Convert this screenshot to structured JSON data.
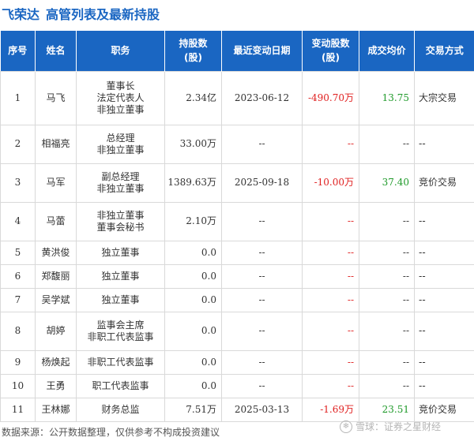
{
  "title": {
    "company": "飞荣达",
    "subtitle": "高管列表及最新持股"
  },
  "table": {
    "headers": [
      "序号",
      "姓名",
      "职务",
      "持股数\n(股)",
      "最近变动日期",
      "变动股数\n(股)",
      "成交均价",
      "交易方式"
    ],
    "rows": [
      {
        "no": "1",
        "name": "马飞",
        "roles": [
          "董事长",
          "法定代表人",
          "非独立董事"
        ],
        "shares": "2.34亿",
        "date": "2023-06-12",
        "change": "-490.70万",
        "price": "13.75",
        "method": "大宗交易"
      },
      {
        "no": "2",
        "name": "相福亮",
        "roles": [
          "总经理",
          "非独立董事"
        ],
        "shares": "33.00万",
        "date": "--",
        "change": "--",
        "price": "--",
        "method": "--"
      },
      {
        "no": "3",
        "name": "马军",
        "roles": [
          "副总经理",
          "非独立董事"
        ],
        "shares": "1389.63万",
        "date": "2025-09-18",
        "change": "-10.00万",
        "price": "37.40",
        "method": "竞价交易"
      },
      {
        "no": "4",
        "name": "马蕾",
        "roles": [
          "非独立董事",
          "董事会秘书"
        ],
        "shares": "2.10万",
        "date": "--",
        "change": "--",
        "price": "--",
        "method": "--"
      },
      {
        "no": "5",
        "name": "黄洪俊",
        "roles": [
          "独立董事"
        ],
        "shares": "0.0",
        "date": "--",
        "change": "--",
        "price": "--",
        "method": "--"
      },
      {
        "no": "6",
        "name": "郑馥丽",
        "roles": [
          "独立董事"
        ],
        "shares": "0.0",
        "date": "--",
        "change": "--",
        "price": "--",
        "method": "--"
      },
      {
        "no": "7",
        "name": "吴学斌",
        "roles": [
          "独立董事"
        ],
        "shares": "0.0",
        "date": "--",
        "change": "--",
        "price": "--",
        "method": "--"
      },
      {
        "no": "8",
        "name": "胡婷",
        "roles": [
          "监事会主席",
          "非职工代表监事"
        ],
        "shares": "0.0",
        "date": "--",
        "change": "--",
        "price": "--",
        "method": "--"
      },
      {
        "no": "9",
        "name": "杨焕起",
        "roles": [
          "非职工代表监事"
        ],
        "shares": "0.0",
        "date": "--",
        "change": "--",
        "price": "--",
        "method": "--"
      },
      {
        "no": "10",
        "name": "王勇",
        "roles": [
          "职工代表监事"
        ],
        "shares": "0.0",
        "date": "--",
        "change": "--",
        "price": "--",
        "method": "--"
      },
      {
        "no": "11",
        "name": "王林娜",
        "roles": [
          "财务总监"
        ],
        "shares": "7.51万",
        "date": "2025-03-13",
        "change": "-1.69万",
        "price": "23.51",
        "method": "竞价交易"
      }
    ]
  },
  "footer": {
    "source": "数据来源：公开数据整理，仅供参考不构成投资建议"
  },
  "watermark": {
    "icon": "snowball-icon",
    "text": "雪球：证券之星财经"
  },
  "colors": {
    "header_bg": "#1a66c2",
    "title": "#1a66c2",
    "negative": "#e02020",
    "positive": "#1f9a2a"
  }
}
